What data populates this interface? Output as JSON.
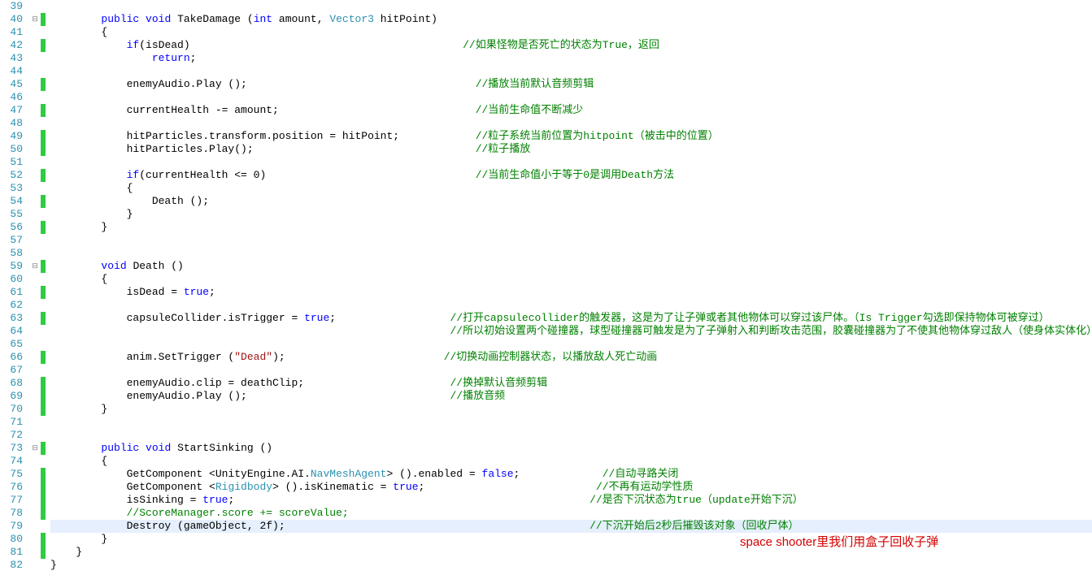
{
  "lines": {
    "start": 39,
    "end": 82
  },
  "fold": {
    "40": "⊟",
    "59": "⊟",
    "73": "⊟"
  },
  "marks_green": [
    40,
    42,
    45,
    47,
    49,
    50,
    52,
    54,
    56,
    59,
    61,
    63,
    66,
    68,
    69,
    70,
    73,
    75,
    76,
    77,
    78,
    80,
    81
  ],
  "highlighted_line": 79,
  "code": {
    "39": "",
    "40": {
      "tokens": [
        [
          "        ",
          ""
        ],
        [
          "public",
          "kw"
        ],
        [
          " ",
          ""
        ],
        [
          "void",
          "kw"
        ],
        [
          " TakeDamage (",
          ""
        ],
        [
          "int",
          "kw"
        ],
        [
          " amount, ",
          ""
        ],
        [
          "Vector3",
          "tp"
        ],
        [
          " hitPoint)",
          ""
        ]
      ]
    },
    "41": {
      "tokens": [
        [
          "        {",
          ""
        ]
      ]
    },
    "42": {
      "tokens": [
        [
          "            ",
          ""
        ],
        [
          "if",
          "kw"
        ],
        [
          "(isDead)                                           ",
          ""
        ],
        [
          "//如果怪物是否死亡的状态为True，返回",
          "cm"
        ]
      ]
    },
    "43": {
      "tokens": [
        [
          "                ",
          ""
        ],
        [
          "return",
          "kw"
        ],
        [
          ";",
          ""
        ]
      ]
    },
    "44": "",
    "45": {
      "tokens": [
        [
          "            enemyAudio.Play ();                                    ",
          ""
        ],
        [
          "//播放当前默认音频剪辑",
          "cm"
        ]
      ]
    },
    "46": "",
    "47": {
      "tokens": [
        [
          "            currentHealth -= amount;                               ",
          ""
        ],
        [
          "//当前生命值不断减少",
          "cm"
        ]
      ]
    },
    "48": "",
    "49": {
      "tokens": [
        [
          "            hitParticles.transform.position = hitPoint;            ",
          ""
        ],
        [
          "//粒子系统当前位置为hitpoint（被击中的位置）",
          "cm"
        ]
      ]
    },
    "50": {
      "tokens": [
        [
          "            hitParticles.Play();                                   ",
          ""
        ],
        [
          "//粒子播放",
          "cm"
        ]
      ]
    },
    "51": "",
    "52": {
      "tokens": [
        [
          "            ",
          ""
        ],
        [
          "if",
          "kw"
        ],
        [
          "(currentHealth <= 0)                                 ",
          ""
        ],
        [
          "//当前生命值小于等于0是调用Death方法",
          "cm"
        ]
      ]
    },
    "53": {
      "tokens": [
        [
          "            {",
          ""
        ]
      ]
    },
    "54": {
      "tokens": [
        [
          "                Death ();",
          ""
        ]
      ]
    },
    "55": {
      "tokens": [
        [
          "            }",
          ""
        ]
      ]
    },
    "56": {
      "tokens": [
        [
          "        }",
          ""
        ]
      ]
    },
    "57": "",
    "58": "",
    "59": {
      "tokens": [
        [
          "        ",
          ""
        ],
        [
          "void",
          "kw"
        ],
        [
          " Death ()",
          ""
        ]
      ]
    },
    "60": {
      "tokens": [
        [
          "        {",
          ""
        ]
      ]
    },
    "61": {
      "tokens": [
        [
          "            isDead = ",
          ""
        ],
        [
          "true",
          "kw"
        ],
        [
          ";",
          ""
        ]
      ]
    },
    "62": "",
    "63": {
      "tokens": [
        [
          "            capsuleCollider.isTrigger = ",
          ""
        ],
        [
          "true",
          "kw"
        ],
        [
          ";                  ",
          ""
        ],
        [
          "//打开capsulecollider的触发器，这是为了让子弹或者其他物体可以穿过该尸体。（Is Trigger勾选即保持物体可被穿过）",
          "cm"
        ]
      ]
    },
    "64": {
      "tokens": [
        [
          "                                                               ",
          ""
        ],
        [
          "//所以初始设置两个碰撞器，球型碰撞器可触发是为了子弹射入和判断攻击范围，胶囊碰撞器为了不使其他物体穿过敌人（使身体实体化）",
          "cm"
        ]
      ]
    },
    "65": "",
    "66": {
      "tokens": [
        [
          "            anim.SetTrigger (",
          ""
        ],
        [
          "\"Dead\"",
          "str"
        ],
        [
          ");                         ",
          ""
        ],
        [
          "//切换动画控制器状态，以播放敌人死亡动画",
          "cm"
        ]
      ]
    },
    "67": "",
    "68": {
      "tokens": [
        [
          "            enemyAudio.clip = deathClip;                       ",
          ""
        ],
        [
          "//换掉默认音频剪辑",
          "cm"
        ]
      ]
    },
    "69": {
      "tokens": [
        [
          "            enemyAudio.Play ();                                ",
          ""
        ],
        [
          "//播放音频",
          "cm"
        ]
      ]
    },
    "70": {
      "tokens": [
        [
          "        }",
          ""
        ]
      ]
    },
    "71": "",
    "72": "",
    "73": {
      "tokens": [
        [
          "        ",
          ""
        ],
        [
          "public",
          "kw"
        ],
        [
          " ",
          ""
        ],
        [
          "void",
          "kw"
        ],
        [
          " StartSinking ()",
          ""
        ]
      ]
    },
    "74": {
      "tokens": [
        [
          "        {",
          ""
        ]
      ]
    },
    "75": {
      "tokens": [
        [
          "            GetComponent <UnityEngine.AI.",
          ""
        ],
        [
          "NavMeshAgent",
          "tp"
        ],
        [
          "> ().enabled = ",
          ""
        ],
        [
          "false",
          "kw"
        ],
        [
          ";             ",
          ""
        ],
        [
          "//自动寻路关闭",
          "cm"
        ]
      ]
    },
    "76": {
      "tokens": [
        [
          "            GetComponent <",
          ""
        ],
        [
          "Rigidbody",
          "tp"
        ],
        [
          "> ().isKinematic = ",
          ""
        ],
        [
          "true",
          "kw"
        ],
        [
          ";                           ",
          ""
        ],
        [
          "//不再有运动学性质",
          "cm"
        ]
      ]
    },
    "77": {
      "tokens": [
        [
          "            isSinking = ",
          ""
        ],
        [
          "true",
          "kw"
        ],
        [
          ";                                                        ",
          ""
        ],
        [
          "//是否下沉状态为true（update开始下沉）",
          "cm"
        ]
      ]
    },
    "78": {
      "tokens": [
        [
          "            ",
          ""
        ],
        [
          "//ScoreManager.score += scoreValue;",
          "cm"
        ]
      ]
    },
    "79": {
      "tokens": [
        [
          "            Destroy (gameObject, 2f);                                                ",
          ""
        ],
        [
          "//下沉开始后2秒后摧毁该对象（回收尸体）",
          "cm"
        ]
      ]
    },
    "80": {
      "tokens": [
        [
          "        }",
          ""
        ]
      ]
    },
    "81": {
      "tokens": [
        [
          "    }",
          ""
        ]
      ]
    },
    "82": "}"
  },
  "annotation": "space shooter里我们用盒子回收子弹"
}
